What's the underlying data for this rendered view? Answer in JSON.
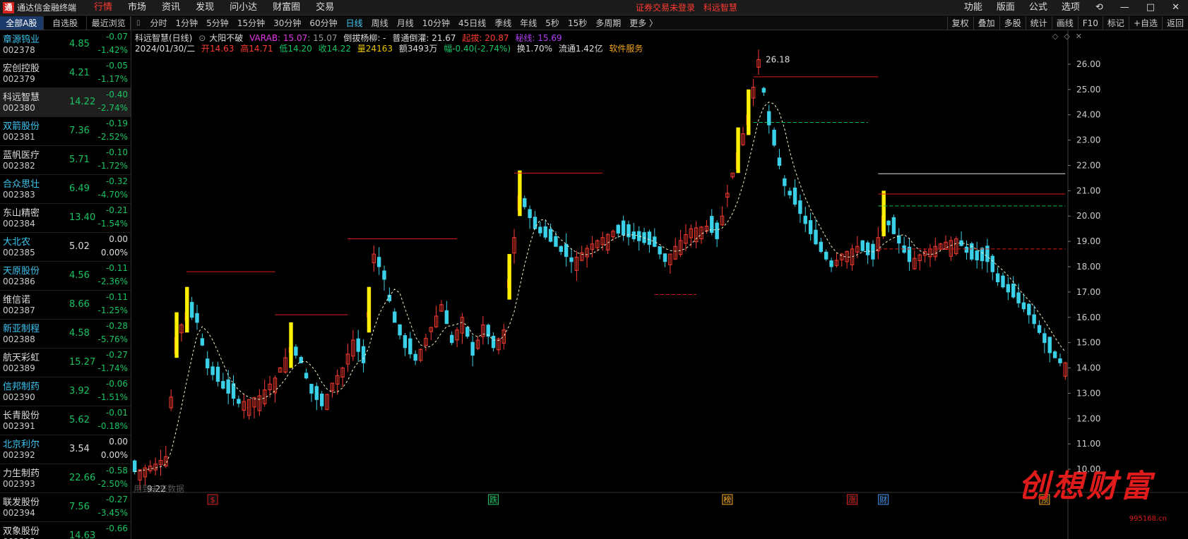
{
  "app": {
    "logo_text": "通",
    "title": "通达信金融终端"
  },
  "menu": [
    "行情",
    "市场",
    "资讯",
    "发现",
    "问小达",
    "财富圈",
    "交易"
  ],
  "active_menu": "行情",
  "notice": {
    "login": "证券交易未登录",
    "stock": "科远智慧"
  },
  "right_menu": [
    "功能",
    "版面",
    "公式",
    "选项",
    "⟲",
    "—",
    "□",
    "✕"
  ],
  "left_tabs": [
    "全部A股",
    "自选股",
    "最近浏览"
  ],
  "stocks": [
    {
      "name": "章源钨业",
      "code": "002378",
      "price": "4.85",
      "chg": "-0.07",
      "pct": "-1.42%",
      "cyan": true,
      "flat": false
    },
    {
      "name": "宏创控股",
      "code": "002379",
      "price": "4.21",
      "chg": "-0.05",
      "pct": "-1.17%",
      "cyan": false,
      "flat": false
    },
    {
      "name": "科远智慧",
      "code": "002380",
      "price": "14.22",
      "chg": "-0.40",
      "pct": "-2.74%",
      "cyan": false,
      "flat": false
    },
    {
      "name": "双箭股份",
      "code": "002381",
      "price": "7.36",
      "chg": "-0.19",
      "pct": "-2.52%",
      "cyan": true,
      "flat": false
    },
    {
      "name": "蓝帆医疗",
      "code": "002382",
      "price": "5.71",
      "chg": "-0.10",
      "pct": "-1.72%",
      "cyan": false,
      "flat": false
    },
    {
      "name": "合众思壮",
      "code": "002383",
      "price": "6.49",
      "chg": "-0.32",
      "pct": "-4.70%",
      "cyan": true,
      "flat": false
    },
    {
      "name": "东山精密",
      "code": "002384",
      "price": "13.40",
      "chg": "-0.21",
      "pct": "-1.54%",
      "cyan": false,
      "flat": false
    },
    {
      "name": "大北农",
      "code": "002385",
      "price": "5.02",
      "chg": "0.00",
      "pct": "0.00%",
      "cyan": true,
      "flat": true
    },
    {
      "name": "天原股份",
      "code": "002386",
      "price": "4.56",
      "chg": "-0.11",
      "pct": "-2.36%",
      "cyan": true,
      "flat": false
    },
    {
      "name": "维信诺",
      "code": "002387",
      "price": "8.66",
      "chg": "-0.11",
      "pct": "-1.25%",
      "cyan": false,
      "flat": false
    },
    {
      "name": "新亚制程",
      "code": "002388",
      "price": "4.58",
      "chg": "-0.28",
      "pct": "-5.76%",
      "cyan": true,
      "flat": false
    },
    {
      "name": "航天彩虹",
      "code": "002389",
      "price": "15.27",
      "chg": "-0.27",
      "pct": "-1.74%",
      "cyan": false,
      "flat": false
    },
    {
      "name": "信邦制药",
      "code": "002390",
      "price": "3.92",
      "chg": "-0.06",
      "pct": "-1.51%",
      "cyan": true,
      "flat": false
    },
    {
      "name": "长青股份",
      "code": "002391",
      "price": "5.62",
      "chg": "-0.01",
      "pct": "-0.18%",
      "cyan": false,
      "flat": false
    },
    {
      "name": "北京利尔",
      "code": "002392",
      "price": "3.54",
      "chg": "0.00",
      "pct": "0.00%",
      "cyan": true,
      "flat": true
    },
    {
      "name": "力生制药",
      "code": "002393",
      "price": "22.66",
      "chg": "-0.58",
      "pct": "-2.50%",
      "cyan": false,
      "flat": false
    },
    {
      "name": "联发股份",
      "code": "002394",
      "price": "7.56",
      "chg": "-0.27",
      "pct": "-3.45%",
      "cyan": false,
      "flat": false
    },
    {
      "name": "双象股份",
      "code": "002395",
      "price": "14.63",
      "chg": "-0.66",
      "pct": "",
      "cyan": false,
      "flat": false
    }
  ],
  "selected_stock_index": 2,
  "periods": [
    "分时",
    "1分钟",
    "5分钟",
    "15分钟",
    "30分钟",
    "60分钟",
    "日线",
    "周线",
    "月线",
    "10分钟",
    "45日线",
    "季线",
    "年线",
    "5秒",
    "15秒",
    "多周期",
    "更多 〉"
  ],
  "active_period": "日线",
  "right_tools": [
    "复权",
    "叠加",
    "多股",
    "统计",
    "画线",
    "F10",
    "标记",
    "+自选",
    "返回"
  ],
  "info_line1": {
    "title": "科远智慧(日线)",
    "formula": "大阳不破",
    "varab": "VARAB: 15.07",
    "varab2": ": 15.07",
    "line3": "倒拔杨柳: -",
    "line4": "普通倒灌: 21.67",
    "line5": "起拔: 20.87",
    "line6": "秘线: 15.69"
  },
  "info_line2": {
    "date": "2024/01/30/二",
    "open": "开14.63",
    "high": "高14.71",
    "low": "低14.20",
    "close": "收14.22",
    "vol": "量24163",
    "amt": "额3493万",
    "chg": "幅-0.40(-2.74%)",
    "turn": "换1.70%",
    "float": "流通1.42亿",
    "sector": "软件服务"
  },
  "chart_tools": [
    "◇",
    "◇",
    "✕"
  ],
  "hint_text": "用到未来数据",
  "brand": {
    "text": "创想财富",
    "site": "995168.cn"
  },
  "chart_data": {
    "type": "candlestick",
    "period": "daily",
    "ylim": [
      9.5,
      26.5
    ],
    "y_ticks": [
      10.0,
      11.0,
      12.0,
      13.0,
      14.0,
      15.0,
      16.0,
      17.0,
      18.0,
      19.0,
      20.0,
      21.0,
      22.0,
      23.0,
      24.0,
      25.0,
      26.0
    ],
    "y_tick_labels": [
      "10.00",
      "11.00",
      "12.00",
      "13.00",
      "14.00",
      "15.00",
      "16.00",
      "17.00",
      "18.00",
      "19.00",
      "20.00",
      "21.00",
      "22.00",
      "23.00",
      "24.00",
      "25.00",
      "26.00"
    ],
    "price_path": [
      [
        0,
        9.9
      ],
      [
        4,
        10.2
      ],
      [
        6,
        10.5
      ],
      [
        8,
        15.2
      ],
      [
        10,
        16.2
      ],
      [
        12,
        15.8
      ],
      [
        14,
        14.0
      ],
      [
        17,
        13.2
      ],
      [
        20,
        12.6
      ],
      [
        24,
        12.9
      ],
      [
        27,
        13.6
      ],
      [
        30,
        14.8
      ],
      [
        32,
        14.2
      ],
      [
        34,
        13.0
      ],
      [
        36,
        12.5
      ],
      [
        38,
        13.4
      ],
      [
        40,
        14.0
      ],
      [
        42,
        15.1
      ],
      [
        44,
        14.2
      ],
      [
        45,
        16.2
      ],
      [
        46,
        18.5
      ],
      [
        48,
        17.5
      ],
      [
        50,
        15.8
      ],
      [
        52,
        14.8
      ],
      [
        54,
        14.3
      ],
      [
        57,
        15.6
      ],
      [
        59,
        16.5
      ],
      [
        61,
        15.0
      ],
      [
        63,
        16.0
      ],
      [
        65,
        14.5
      ],
      [
        67,
        15.7
      ],
      [
        69,
        14.8
      ],
      [
        71,
        15.5
      ],
      [
        72,
        17.5
      ],
      [
        74,
        20.8
      ],
      [
        77,
        19.5
      ],
      [
        80,
        19.0
      ],
      [
        84,
        18.2
      ],
      [
        88,
        18.9
      ],
      [
        92,
        19.4
      ],
      [
        96,
        19.1
      ],
      [
        100,
        18.8
      ],
      [
        102,
        18.2
      ],
      [
        104,
        18.8
      ],
      [
        107,
        19.5
      ],
      [
        110,
        19.6
      ],
      [
        112,
        19.1
      ],
      [
        114,
        20.9
      ],
      [
        116,
        22.5
      ],
      [
        118,
        24.0
      ],
      [
        120,
        26.18
      ],
      [
        122,
        23.6
      ],
      [
        125,
        21.2
      ],
      [
        128,
        20.1
      ],
      [
        131,
        18.9
      ],
      [
        134,
        18.0
      ],
      [
        136,
        18.5
      ],
      [
        139,
        18.8
      ],
      [
        142,
        18.3
      ],
      [
        144,
        20.0
      ],
      [
        146,
        19.3
      ],
      [
        149,
        18.2
      ],
      [
        152,
        18.6
      ],
      [
        155,
        18.9
      ],
      [
        158,
        19.1
      ],
      [
        161,
        18.3
      ],
      [
        164,
        18.2
      ],
      [
        166,
        17.4
      ],
      [
        169,
        16.8
      ],
      [
        172,
        16.1
      ],
      [
        174,
        15.4
      ],
      [
        176,
        14.6
      ],
      [
        178,
        14.2
      ]
    ],
    "annotations": [
      {
        "label": "26.18",
        "x": 120,
        "y": 26.18
      },
      {
        "label": "9.22",
        "x": 1,
        "y": 9.22
      }
    ],
    "levels": [
      {
        "kind": "resistance",
        "y": 17.8,
        "x0": 10,
        "x1": 27
      },
      {
        "kind": "resistance",
        "y": 16.1,
        "x0": 27,
        "x1": 41
      },
      {
        "kind": "resistance",
        "y": 19.1,
        "x0": 41,
        "x1": 62
      },
      {
        "kind": "resistance",
        "y": 21.7,
        "x0": 73,
        "x1": 90
      },
      {
        "kind": "resistance",
        "y": 25.5,
        "x0": 119,
        "x1": 143
      },
      {
        "kind": "resistance",
        "y": 20.87,
        "x0": 143,
        "x1": 180
      },
      {
        "kind": "support",
        "y": 18.7,
        "x0": 143,
        "x1": 180
      },
      {
        "kind": "green",
        "y": 20.4,
        "x0": 143,
        "x1": 180
      },
      {
        "kind": "white",
        "y": 21.67,
        "x0": 143,
        "x1": 180
      },
      {
        "kind": "green",
        "y": 23.7,
        "x0": 119,
        "x1": 141
      },
      {
        "kind": "support",
        "y": 16.9,
        "x0": 100,
        "x1": 108
      }
    ],
    "bottom_markers": [
      {
        "label": "$",
        "x": 15,
        "color": "#e01b1b"
      },
      {
        "label": "跌",
        "x": 69,
        "color": "#18c463"
      },
      {
        "label": "榜",
        "x": 114,
        "color": "#f2a41c"
      },
      {
        "label": "涨",
        "x": 138,
        "color": "#e01b1b"
      },
      {
        "label": "财",
        "x": 144,
        "color": "#3c8cf0"
      },
      {
        "label": "预",
        "x": 175,
        "color": "#f2a41c"
      }
    ],
    "x_count": 180
  }
}
